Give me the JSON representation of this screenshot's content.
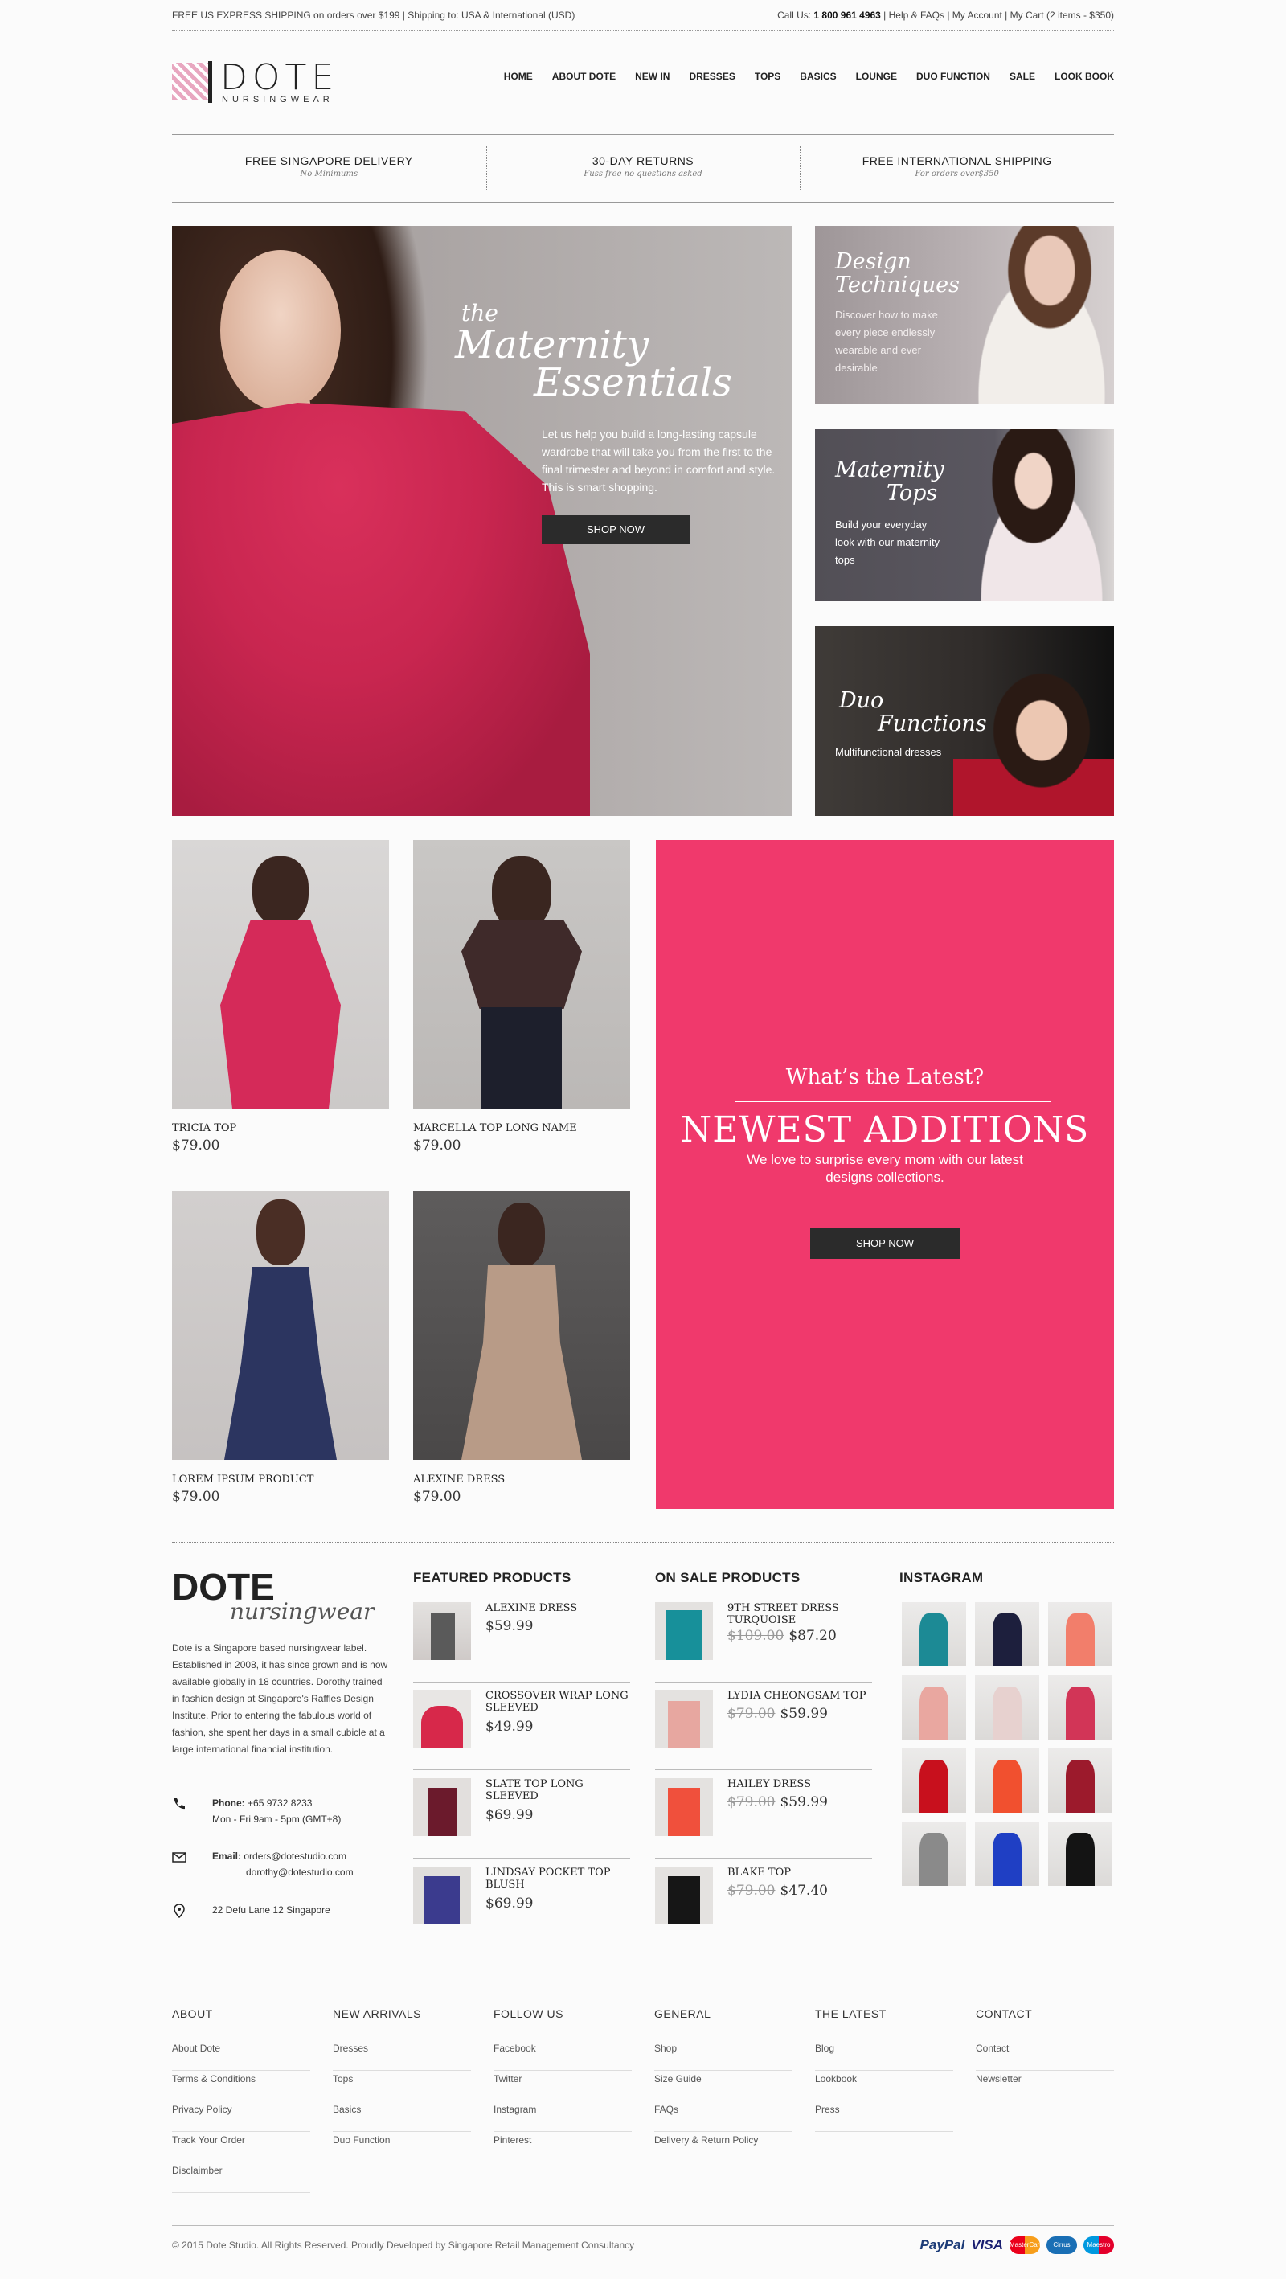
{
  "topbar": {
    "left": "FREE US EXPRESS SHIPPING on orders over $199  | Shipping to: USA & International (USD)",
    "call_label": "Call Us:",
    "phone": "1 800 961 4963",
    "help": "Help & FAQs",
    "account": "My Account",
    "cart": "My Cart (2 items - $350)"
  },
  "brand": {
    "name": "DOTE",
    "sub": "NURSINGWEAR"
  },
  "nav": [
    "HOME",
    "ABOUT DOTE",
    "NEW IN",
    "DRESSES",
    "TOPS",
    "BASICS",
    "LOUNGE",
    "DUO FUNCTION",
    "SALE",
    "LOOK BOOK"
  ],
  "usp": [
    {
      "title": "FREE SINGAPORE DELIVERY",
      "sub": "No Minimums"
    },
    {
      "title": "30-DAY RETURNS",
      "sub": "Fuss free no questions asked"
    },
    {
      "title": "FREE INTERNATIONAL SHIPPING",
      "sub": "For orders over$350"
    }
  ],
  "hero": {
    "the": "the",
    "line1": "Maternity",
    "line2": "Essentials",
    "desc": "Let us help you build a long-lasting capsule wardrobe that will take you from the first to the final trimester and beyond in comfort and style. This is smart shopping.",
    "button": "SHOP NOW"
  },
  "side": [
    {
      "title1": "Design",
      "title2": "Techniques",
      "desc": "Discover how to make every piece endlessly wearable and ever desirable"
    },
    {
      "title1": "Maternity",
      "title2": "Tops",
      "desc": "Build your everyday look with our maternity tops"
    },
    {
      "title1": "Duo",
      "title2": "Functions",
      "desc": "Multifunctional dresses"
    }
  ],
  "products": [
    {
      "name": "TRICIA TOP",
      "price": "$79.00"
    },
    {
      "name": "MARCELLA TOP LONG NAME",
      "price": "$79.00"
    },
    {
      "name": "LOREM IPSUM PRODUCT",
      "price": "$79.00"
    },
    {
      "name": "ALEXINE DRESS",
      "price": "$79.00"
    }
  ],
  "newest": {
    "question": "What’s the Latest?",
    "heading": "NEWEST ADDITIONS",
    "desc": "We love to surprise every mom with our latest designs collections.",
    "button": "SHOP NOW"
  },
  "about": {
    "brand1": "DOTE",
    "brand2": "nursingwear",
    "text": "Dote is a Singapore based nursingwear label. Established in 2008, it has since grown and is now available globally in 18 countries. Dorothy trained in fashion design at Singapore's Raffles Design Institute. Prior to entering the fabulous world of fashion, she spent her days in a small cubicle at a large international financial institution.",
    "phone_label": "Phone:",
    "phone": "+65 9732 8233",
    "hours": "Mon - Fri 9am - 5pm (GMT+8)",
    "email_label": "Email:",
    "email1": "orders@dotestudio.com",
    "email2": "dorothy@dotestudio.com",
    "address": "22 Defu Lane 12 Singapore"
  },
  "featured": {
    "title": "FEATURED PRODUCTS",
    "items": [
      {
        "name": "ALEXINE DRESS",
        "price": "$59.99"
      },
      {
        "name": "CROSSOVER WRAP LONG SLEEVED",
        "price": "$49.99"
      },
      {
        "name": "SLATE TOP LONG SLEEVED",
        "price": "$69.99"
      },
      {
        "name": "LINDSAY POCKET TOP BLUSH",
        "price": "$69.99"
      }
    ]
  },
  "sale": {
    "title": "ON SALE PRODUCTS",
    "items": [
      {
        "name": "9TH STREET DRESS TURQUOISE",
        "old": "$109.00",
        "price": "$87.20"
      },
      {
        "name": "LYDIA CHEONGSAM TOP",
        "old": "$79.00",
        "price": "$59.99"
      },
      {
        "name": "HAILEY DRESS",
        "old": "$79.00",
        "price": "$59.99"
      },
      {
        "name": "BLAKE TOP",
        "old": "$79.00",
        "price": "$47.40"
      }
    ]
  },
  "instagram": {
    "title": "INSTAGRAM",
    "colors": [
      "#1c8a95",
      "#1d1f3d",
      "#f27e6b",
      "#e9a7a0",
      "#e7d1cf",
      "#d23557",
      "#c8101d",
      "#f1502f",
      "#9c1a2c",
      "#8a8a8a",
      "#1f3fc4",
      "#141414"
    ]
  },
  "footer": {
    "cols": [
      {
        "title": "ABOUT",
        "links": [
          "About Dote",
          "Terms & Conditions",
          "Privacy Policy",
          "Track Your Order",
          "Disclaimber"
        ]
      },
      {
        "title": "NEW ARRIVALS",
        "links": [
          "Dresses",
          "Tops",
          "Basics",
          "Duo Function"
        ]
      },
      {
        "title": "FOLLOW US",
        "links": [
          "Facebook",
          "Twitter",
          "Instagram",
          "Pinterest"
        ]
      },
      {
        "title": "GENERAL",
        "links": [
          "Shop",
          "Size Guide",
          "FAQs",
          "Delivery & Return Policy"
        ]
      },
      {
        "title": "THE LATEST",
        "links": [
          "Blog",
          "Lookbook",
          "Press"
        ]
      },
      {
        "title": "CONTACT",
        "links": [
          "Contact",
          "Newsletter"
        ]
      }
    ],
    "copyright": "© 2015 Dote Studio. All Rights Reserved. Proudly Developed by Singapore Retail Management Consultancy",
    "payments": {
      "paypal": "PayPal",
      "visa": "VISA",
      "mastercard": "MasterCard",
      "cirrus": "Cirrus",
      "maestro": "Maestro"
    }
  }
}
